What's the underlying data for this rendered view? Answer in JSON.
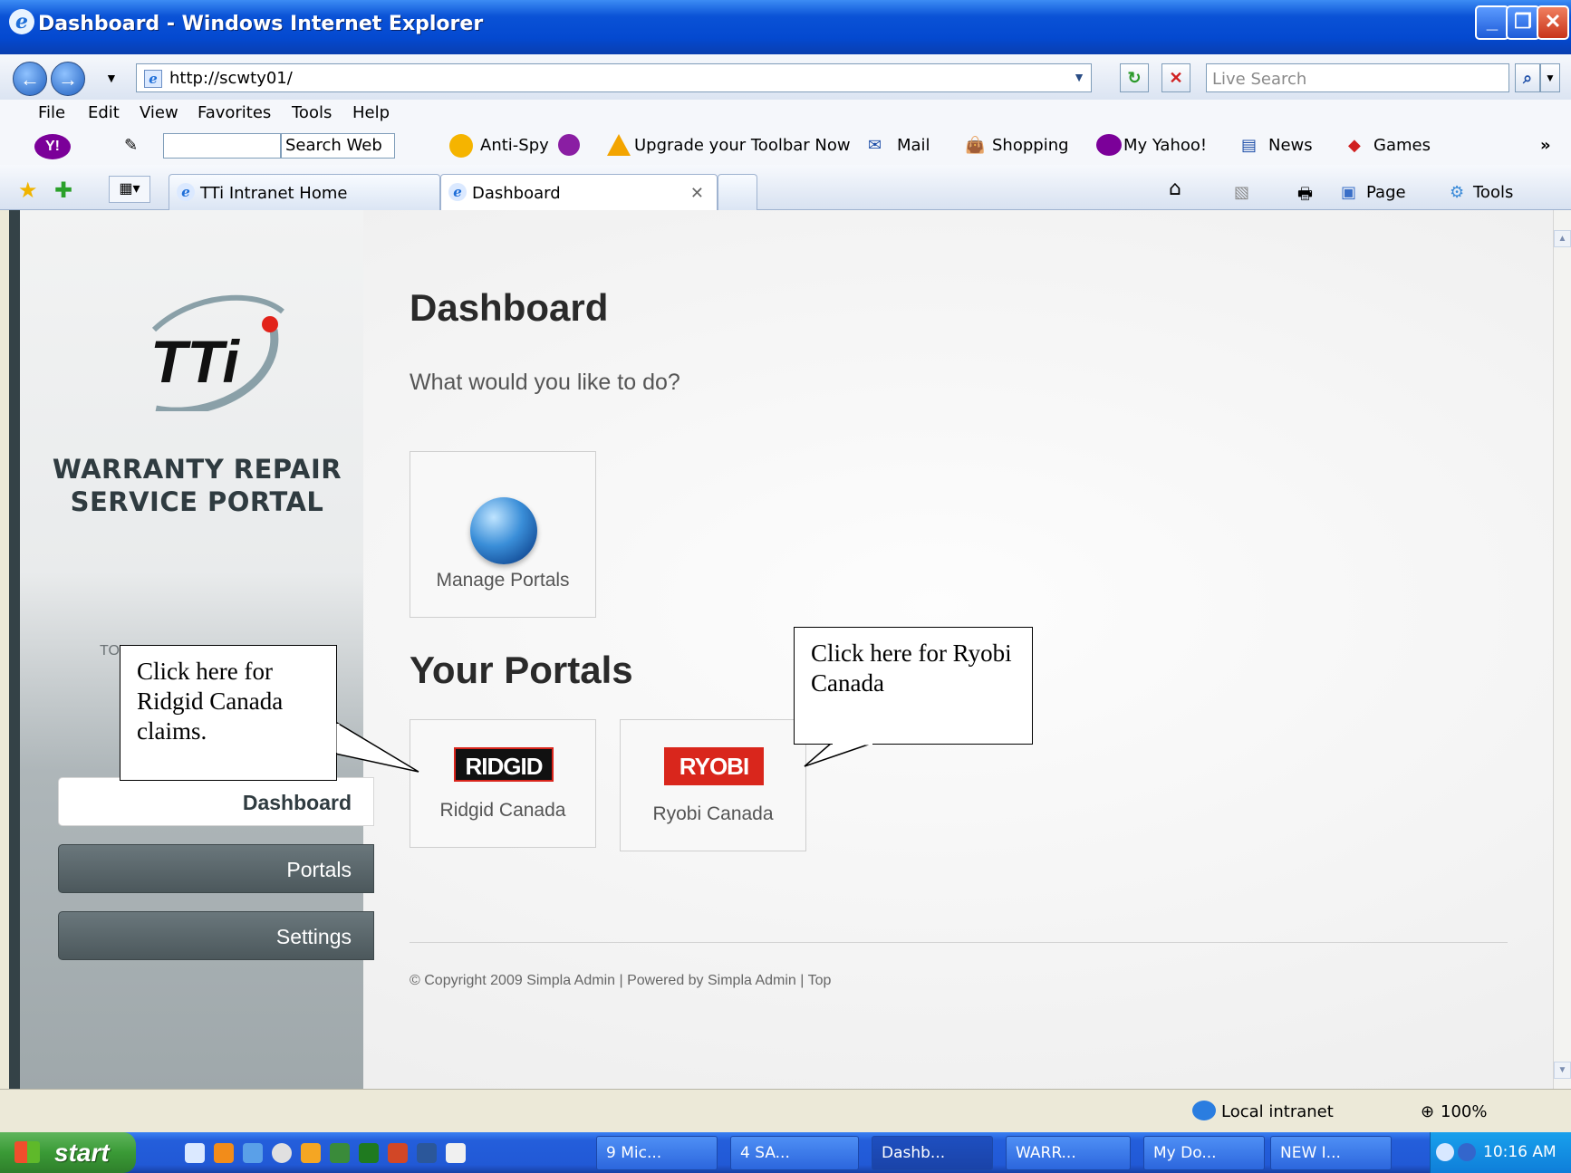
{
  "window": {
    "title": "Dashboard - Windows Internet Explorer",
    "minimize": "_",
    "maximize": "❐",
    "close": "✕"
  },
  "address": {
    "url": "http://scwty01/",
    "search_placeholder": "Live Search"
  },
  "menu": [
    "File",
    "Edit",
    "View",
    "Favorites",
    "Tools",
    "Help"
  ],
  "yahoo_toolbar": {
    "search_web": "Search Web",
    "anti_spy": "Anti-Spy",
    "upgrade": "Upgrade your Toolbar Now",
    "mail": "Mail",
    "shopping": "Shopping",
    "my_yahoo": "My Yahoo!",
    "news": "News",
    "games": "Games",
    "more": "»"
  },
  "tabs": [
    {
      "label": "TTi Intranet Home"
    },
    {
      "label": "Dashboard"
    }
  ],
  "command_bar": {
    "page": "Page",
    "tools": "Tools"
  },
  "sidebar": {
    "portal_title_line1": "WARRANTY REPAIR",
    "portal_title_line2": "SERVICE PORTAL",
    "tagline": "TO",
    "nav": [
      {
        "label": "Dashboard"
      },
      {
        "label": "Portals"
      },
      {
        "label": "Settings"
      }
    ]
  },
  "main": {
    "title": "Dashboard",
    "subtitle": "What would you like to do?",
    "manage_portals": "Manage Portals",
    "your_portals": "Your Portals",
    "portals": [
      {
        "logo": "RIDGID",
        "label": "Ridgid Canada"
      },
      {
        "logo": "RYOBI",
        "label": "Ryobi Canada"
      }
    ],
    "copyright": "© Copyright 2009 Simpla Admin | Powered by Simpla Admin | Top"
  },
  "callouts": {
    "ridgid": "Click here for Ridgid Canada claims.",
    "ryobi": "Click here for Ryobi Canada"
  },
  "status": {
    "zone": "Local intranet",
    "zoom": "100%"
  },
  "taskbar": {
    "start": "start",
    "tasks": [
      "9 Mic...",
      "4 SA...",
      "Dashb...",
      "WARR...",
      "My Do...",
      "NEW I..."
    ],
    "clock": "10:16 AM"
  },
  "colors": {
    "sidebar_dark": "#344247",
    "ridgid_red": "#d9251c",
    "ryobi_red": "#d9261c",
    "xp_blue": "#0449d0"
  }
}
